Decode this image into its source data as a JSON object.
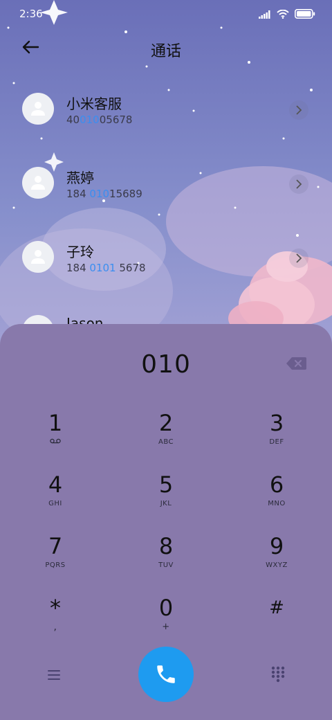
{
  "status_bar": {
    "time": "2:36",
    "icons": [
      "signal-icon",
      "wifi-icon",
      "battery-icon"
    ]
  },
  "header": {
    "title": "通话",
    "back_icon": "arrow-left-icon"
  },
  "contacts": [
    {
      "name": "小米客服",
      "number_pre": "40",
      "number_hl": "010",
      "number_post": "05678"
    },
    {
      "name": "燕婷",
      "number_pre": "184 ",
      "number_hl": "010",
      "number_post": "15689"
    },
    {
      "name": "子玲",
      "number_pre": "184 ",
      "number_hl": "0101",
      "number_post": " 5678"
    },
    {
      "name": "Jason",
      "number_pre": "",
      "number_hl": "",
      "number_post": ""
    }
  ],
  "dialer": {
    "entry": "010",
    "keys": [
      {
        "digit": "1",
        "letters": ""
      },
      {
        "digit": "2",
        "letters": "ABC"
      },
      {
        "digit": "3",
        "letters": "DEF"
      },
      {
        "digit": "4",
        "letters": "GHI"
      },
      {
        "digit": "5",
        "letters": "JKL"
      },
      {
        "digit": "6",
        "letters": "MNO"
      },
      {
        "digit": "7",
        "letters": "PQRS"
      },
      {
        "digit": "8",
        "letters": "TUV"
      },
      {
        "digit": "9",
        "letters": "WXYZ"
      },
      {
        "digit": "*",
        "letters": ","
      },
      {
        "digit": "0",
        "letters": "+"
      },
      {
        "digit": "#",
        "letters": ""
      }
    ],
    "voicemail_icon": "voicemail-icon",
    "backspace_icon": "backspace-icon",
    "menu_icon": "menu-icon",
    "call_icon": "phone-icon",
    "keypad_icon": "keypad-icon"
  },
  "colors": {
    "call_button": "#1e9bf0",
    "highlight": "#3a8ef0",
    "dialer_bg": "#8879ab"
  }
}
